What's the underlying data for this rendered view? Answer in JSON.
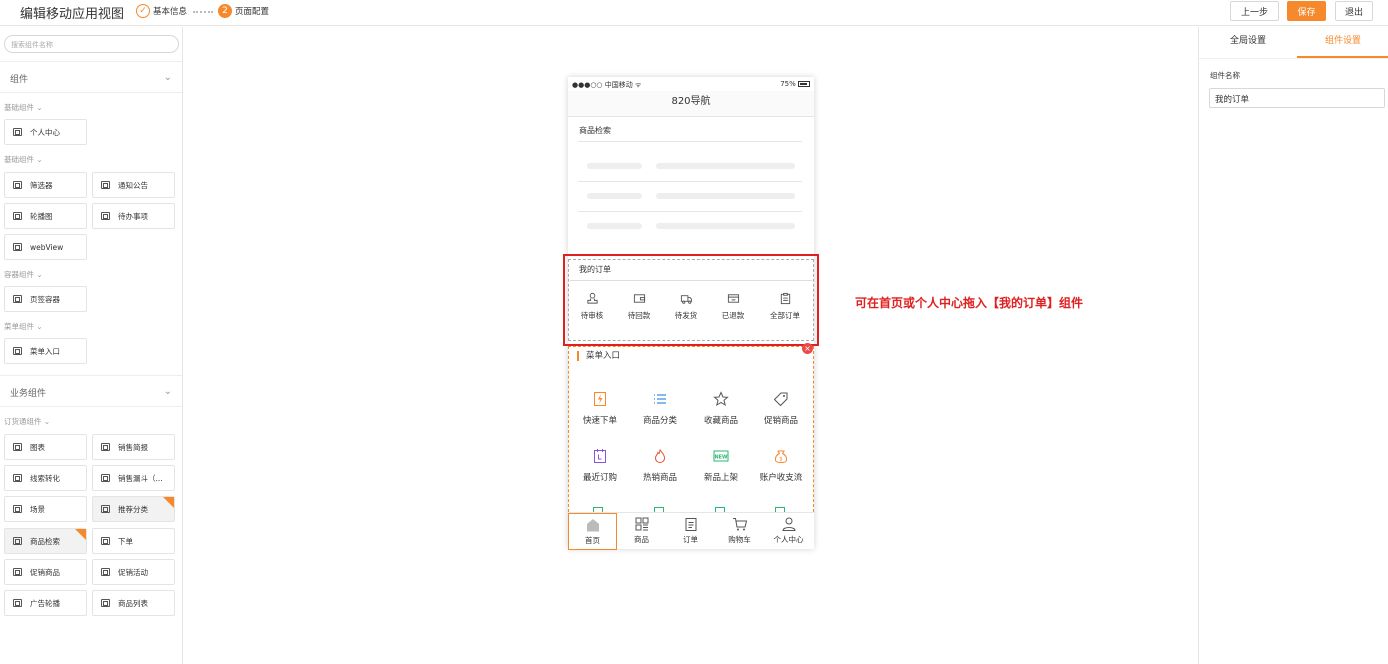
{
  "header": {
    "title": "编辑移动应用视图",
    "step1_label": "基本信息",
    "step2_num": "2",
    "step2_label": "页面配置",
    "prev_label": "上一步",
    "save_label": "保存",
    "exit_label": "退出",
    "accent": "#f5892c"
  },
  "sidebar": {
    "search_placeholder": "搜索组件名称",
    "section1": "组件",
    "section2": "业务组件",
    "groups": {
      "basic1": "基础组件",
      "basic2": "基础组件",
      "container": "容器组件",
      "menu": "菜单组件",
      "order": "订货通组件"
    },
    "components": {
      "personal": "个人中心",
      "filter": "筛选器",
      "notice": "通知公告",
      "carousel": "轮播图",
      "todo": "待办事项",
      "webview": "webView",
      "tabs": "页签容器",
      "menu_entry": "菜单入口",
      "chart": "图表",
      "sales_report": "销售简报",
      "lead": "线索转化",
      "funnel": "销售漏斗（...",
      "scene": "场景",
      "recommend": "推荐分类",
      "product_search": "商品检索",
      "place_order": "下单",
      "promo_product": "促销商品",
      "promo_activity": "促销活动",
      "ad_carousel": "广告轮播",
      "product_list": "商品列表"
    }
  },
  "phone": {
    "carrier": "●●●○○ 中国移动 ᯤ",
    "battery": "75%",
    "nav_title": "820导航",
    "search_block_title": "商品检索",
    "orders_title": "我的订单",
    "orders": [
      "待审核",
      "待回款",
      "待发货",
      "已退款",
      "全部订单"
    ],
    "menu_title": "菜单入口",
    "menu_row1": [
      "快速下单",
      "商品分类",
      "收藏商品",
      "促销商品"
    ],
    "menu_row2": [
      "最近订购",
      "热销商品",
      "新品上架",
      "账户收支流"
    ],
    "new_badge": "NEW",
    "close_mark": "×",
    "tabs": [
      "首页",
      "商品",
      "订单",
      "购物车",
      "个人中心"
    ]
  },
  "annotation": "可在首页或个人中心拖入【我的订单】组件",
  "right_panel": {
    "tab_global": "全局设置",
    "tab_component": "组件设置",
    "field_label": "组件名称",
    "field_value": "我的订单"
  }
}
